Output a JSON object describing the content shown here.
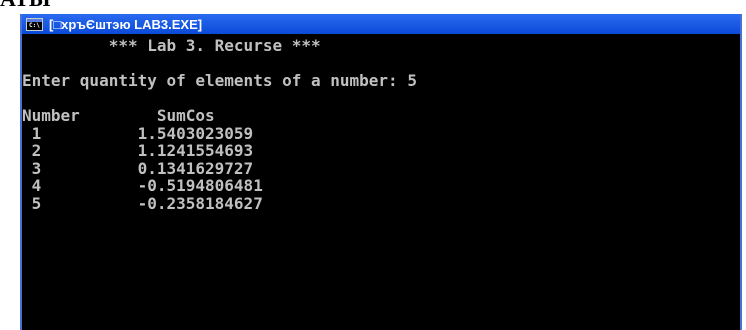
{
  "page": {
    "heading_fragment": "ATЫ"
  },
  "window": {
    "title": "[□хръЄштэю LAB3.EXE]",
    "icon": "cmd-console-icon",
    "icon_text": "C:\\"
  },
  "console": {
    "header": "         *** Lab 3. Recurse ***",
    "prompt": "Enter quantity of elements of a number: 5",
    "columns": "Number        SumCos",
    "rows": [
      " 1          1.5403023059",
      " 2          1.1241554693",
      " 3          0.1341629727",
      " 4          -0.5194806481",
      " 5          -0.2358184627"
    ]
  },
  "colors": {
    "console_bg": "#000000",
    "console_text": "#c0c0c0",
    "titlebar": "#0a4ad8"
  }
}
